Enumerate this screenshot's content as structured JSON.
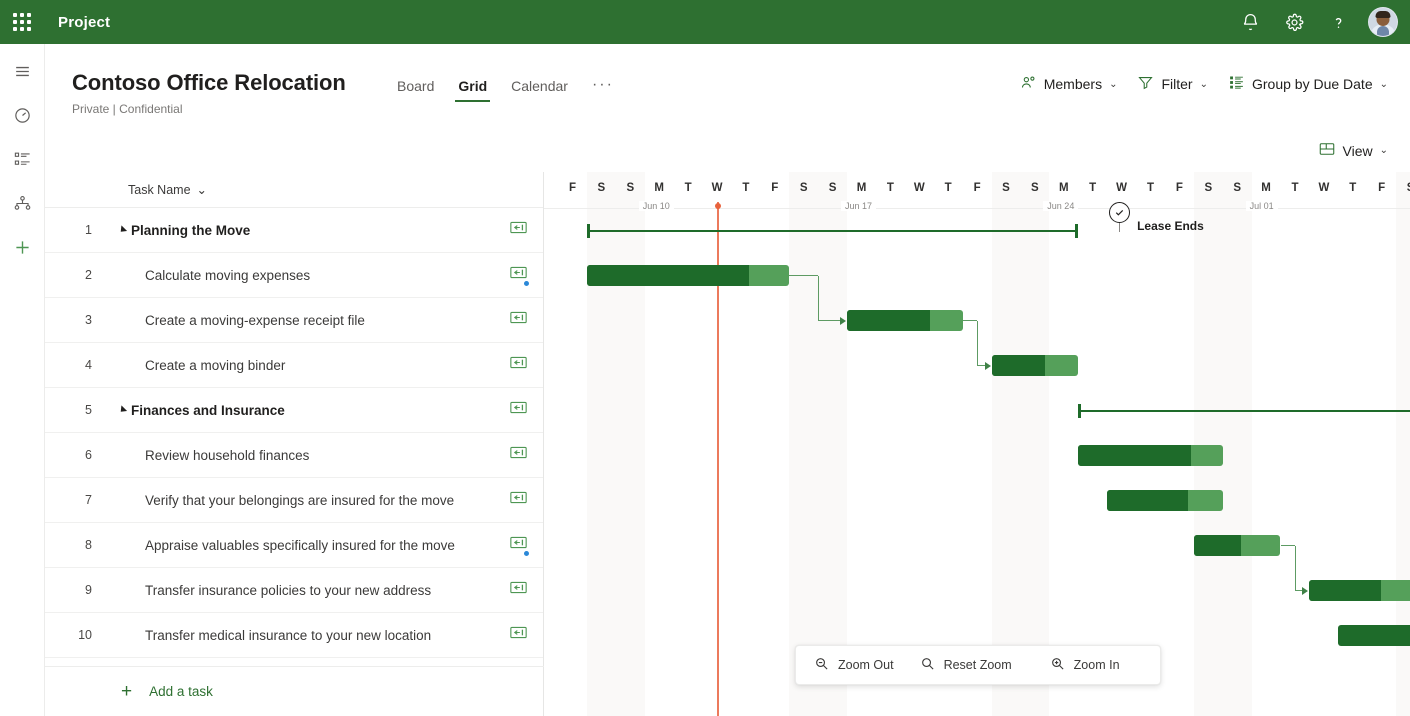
{
  "suite": {
    "app_name": "Project",
    "waffle_icon": "app-launcher-icon",
    "icons": [
      "notification-bell-icon",
      "settings-gear-icon",
      "help-question-icon"
    ],
    "avatar_label": "user-avatar"
  },
  "rail": {
    "items": [
      {
        "name": "hamburger-menu-icon"
      },
      {
        "name": "dashboard-gauge-icon"
      },
      {
        "name": "task-list-icon"
      },
      {
        "name": "org-chart-icon"
      },
      {
        "name": "add-new-icon"
      }
    ]
  },
  "header": {
    "project_title": "Contoso Office Relocation",
    "subtitle": "Private | Confidential",
    "tabs": [
      {
        "label": "Board",
        "active": false
      },
      {
        "label": "Grid",
        "active": true
      },
      {
        "label": "Calendar",
        "active": false
      }
    ],
    "more_label": "···",
    "actions": [
      {
        "label": "Members",
        "icon": "members-icon",
        "chevron": "⌄"
      },
      {
        "label": "Filter",
        "icon": "filter-funnel-icon",
        "chevron": "⌄"
      },
      {
        "label": "Group by Due Date",
        "icon": "group-by-icon",
        "chevron": "⌄"
      }
    ],
    "view": {
      "label": "View",
      "icon": "view-layout-icon",
      "chevron": "⌄"
    }
  },
  "grid": {
    "column_header": "Task Name",
    "sort_chevron": "⌄",
    "add_task_label": "Add a task",
    "add_task_plus": "+",
    "rows": [
      {
        "id": "1",
        "name": "Planning the Move",
        "type": "summary",
        "badge": "task-badge-icon",
        "dot": false
      },
      {
        "id": "2",
        "name": "Calculate moving expenses",
        "type": "task",
        "badge": "task-badge-icon",
        "dot": true
      },
      {
        "id": "3",
        "name": "Create a moving-expense receipt file",
        "type": "task",
        "badge": "task-badge-icon",
        "dot": false
      },
      {
        "id": "4",
        "name": "Create a moving binder",
        "type": "task",
        "badge": "task-badge-icon",
        "dot": false
      },
      {
        "id": "5",
        "name": "Finances and Insurance",
        "type": "summary",
        "badge": "task-badge-icon",
        "dot": false
      },
      {
        "id": "6",
        "name": "Review household finances",
        "type": "task",
        "badge": "task-badge-icon",
        "dot": false
      },
      {
        "id": "7",
        "name": "Verify that your belongings are insured for the move",
        "type": "task",
        "badge": "task-badge-icon",
        "dot": false
      },
      {
        "id": "8",
        "name": "Appraise valuables specifically insured for the move",
        "type": "task",
        "badge": "task-badge-icon",
        "dot": true
      },
      {
        "id": "9",
        "name": "Transfer insurance policies to your new address",
        "type": "task",
        "badge": "task-badge-icon",
        "dot": false
      },
      {
        "id": "10",
        "name": "Transfer medical insurance to your new location",
        "type": "task",
        "badge": "task-badge-icon",
        "dot": false
      }
    ]
  },
  "timeline": {
    "day_labels": [
      "F",
      "S",
      "S",
      "M",
      "T",
      "W",
      "T",
      "F",
      "S",
      "S",
      "M",
      "T",
      "W",
      "T",
      "F",
      "S",
      "S",
      "M",
      "T",
      "W",
      "T",
      "F",
      "S",
      "S",
      "M",
      "T",
      "W",
      "T",
      "F",
      "S"
    ],
    "week_labels": [
      "Jun 10",
      "Jun 17",
      "Jun 24",
      "Jul 01"
    ],
    "weekend_indices": [
      1,
      2,
      8,
      9,
      15,
      16,
      22,
      23,
      29
    ],
    "today_index": 5,
    "milestone": {
      "label": "Lease Ends",
      "icon": "milestone-check-icon",
      "day_index": 19
    },
    "bars": [
      {
        "row": 1,
        "kind": "summary",
        "start": 1,
        "end": 18,
        "progress": 0
      },
      {
        "row": 2,
        "kind": "task",
        "start": 1,
        "end": 8,
        "progress": 0.8
      },
      {
        "row": 3,
        "kind": "task",
        "start": 10,
        "end": 14,
        "progress": 0.72
      },
      {
        "row": 4,
        "kind": "task",
        "start": 15,
        "end": 18,
        "progress": 0.62
      },
      {
        "row": 5,
        "kind": "summary",
        "start": 18,
        "end": 30,
        "progress": 0
      },
      {
        "row": 6,
        "kind": "task",
        "start": 18,
        "end": 23,
        "progress": 0.78
      },
      {
        "row": 7,
        "kind": "task",
        "start": 19,
        "end": 23,
        "progress": 0.7
      },
      {
        "row": 8,
        "kind": "task",
        "start": 22,
        "end": 25,
        "progress": 0.55
      },
      {
        "row": 9,
        "kind": "task",
        "start": 26,
        "end": 30,
        "progress": 0.62
      },
      {
        "row": 10,
        "kind": "task",
        "start": 27,
        "end": 30,
        "progress": 1.0
      }
    ]
  },
  "zoom_bar": {
    "items": [
      {
        "label": "Zoom Out",
        "icon": "zoom-out-icon"
      },
      {
        "label": "Reset Zoom",
        "icon": "reset-zoom-icon"
      },
      {
        "label": "Zoom In",
        "icon": "zoom-in-icon"
      }
    ]
  },
  "colors": {
    "brand_green": "#2e7031",
    "bar_progress": "#1e6b2a",
    "bar_remaining": "#55a05a",
    "today_line": "#ec7a5c",
    "weekend_shade": "#faf9f8",
    "accent_dot": "#2b88d8"
  }
}
